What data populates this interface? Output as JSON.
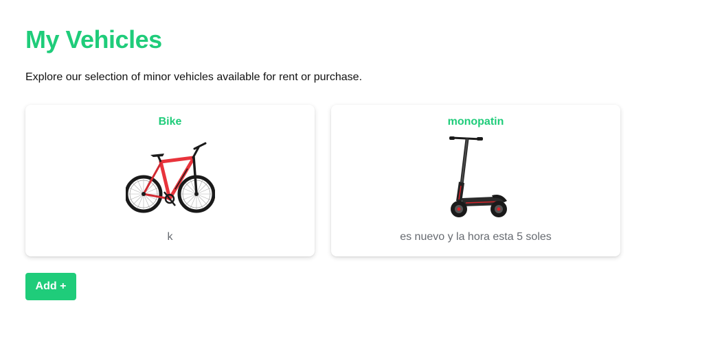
{
  "page": {
    "title": "My Vehicles",
    "subtitle": "Explore our selection of minor vehicles available for rent or purchase."
  },
  "vehicles": [
    {
      "name": "Bike",
      "description": "k",
      "image": "bicycle-photo"
    },
    {
      "name": "monopatin",
      "description": "es nuevo y la hora esta 5 soles",
      "image": "electric-scooter-photo"
    }
  ],
  "actions": {
    "add_label": "Add +"
  },
  "colors": {
    "accent": "#1fcc7a",
    "text": "#111111",
    "muted_text": "#666a70",
    "bike_frame": "#e8343c"
  }
}
